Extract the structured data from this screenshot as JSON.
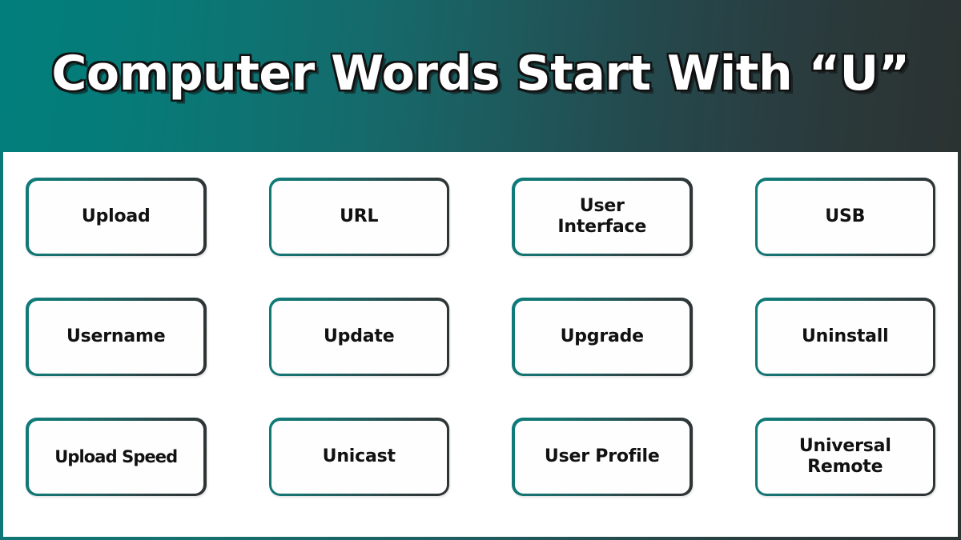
{
  "header": {
    "title": "Computer Words Start With “U”",
    "gradient_start": "#027f7c",
    "gradient_end": "#2b3232"
  },
  "frame": {
    "border_gradient_start": "#0c7a78",
    "border_gradient_end": "#2b3333",
    "background": "#ffffff"
  },
  "card_style": {
    "border_gradient_start": "#0e7c7a",
    "border_gradient_end": "#2f3434",
    "fill": "#fefefe",
    "text_color": "#111111"
  },
  "grid": {
    "columns": 4,
    "rows": 3,
    "cards": [
      {
        "label": "Upload",
        "lines": 1
      },
      {
        "label": "URL",
        "lines": 1
      },
      {
        "label": "User\nInterface",
        "lines": 2
      },
      {
        "label": "USB",
        "lines": 1
      },
      {
        "label": "Username",
        "lines": 1
      },
      {
        "label": "Update",
        "lines": 1
      },
      {
        "label": "Upgrade",
        "lines": 1
      },
      {
        "label": "Uninstall",
        "lines": 1
      },
      {
        "label": "Upload Speed",
        "lines": 1,
        "tight": true
      },
      {
        "label": "Unicast",
        "lines": 1
      },
      {
        "label": "User Profile",
        "lines": 1
      },
      {
        "label": "Universal\nRemote",
        "lines": 2
      }
    ]
  }
}
